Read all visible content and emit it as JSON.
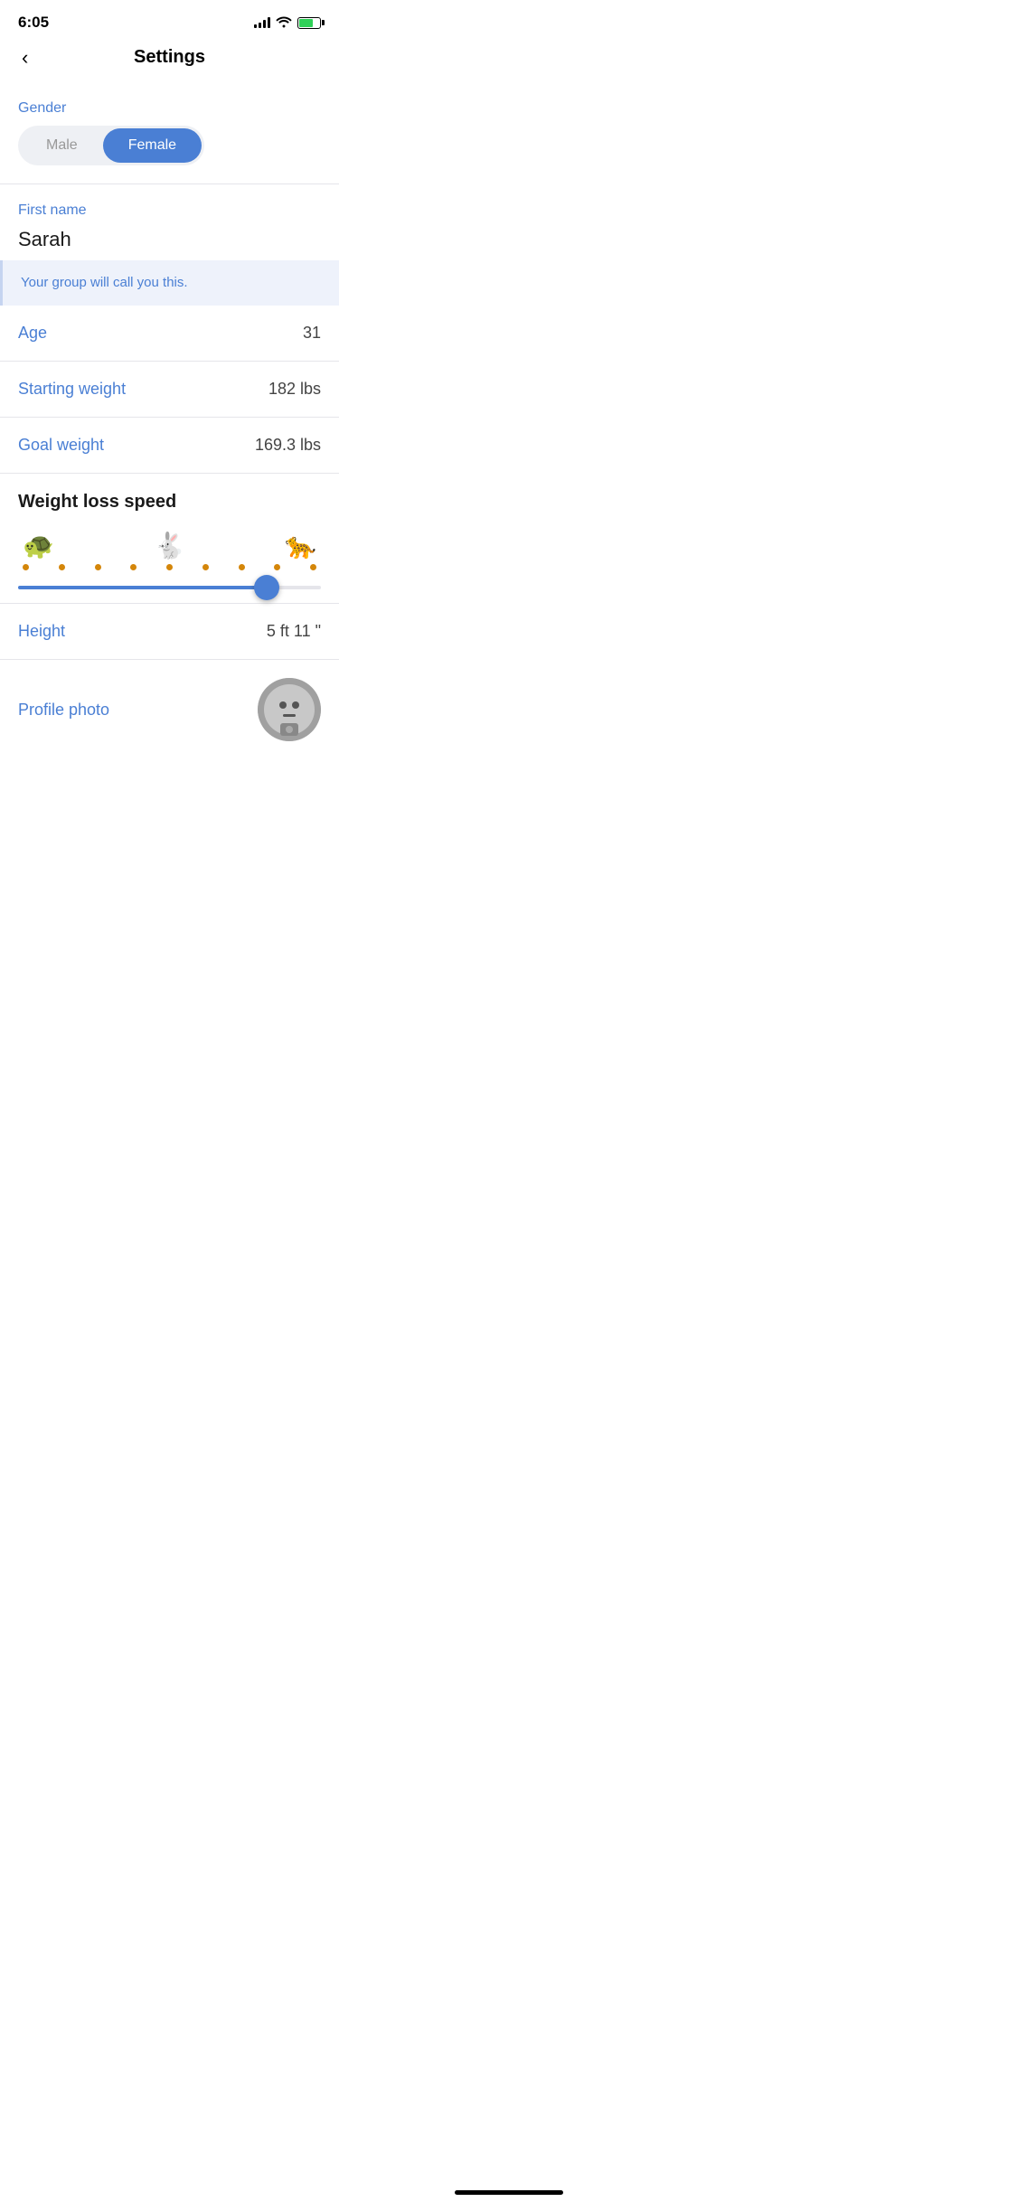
{
  "statusBar": {
    "time": "6:05",
    "batteryColor": "#30d158"
  },
  "header": {
    "backLabel": "‹",
    "title": "Settings"
  },
  "gender": {
    "label": "Gender",
    "options": [
      "Male",
      "Female"
    ],
    "selected": "Female"
  },
  "firstName": {
    "label": "First name",
    "value": "Sarah",
    "tooltip": "Your group will call you this."
  },
  "age": {
    "label": "Age",
    "value": "31"
  },
  "startingWeight": {
    "label": "Starting weight",
    "value": "182 lbs"
  },
  "goalWeight": {
    "label": "Goal weight",
    "value": "169.3 lbs"
  },
  "weightLossSpeed": {
    "title": "Weight loss speed",
    "sliderValue": 85,
    "animals": {
      "slow": "🐢",
      "medium": "🐇",
      "fast": "🐆"
    }
  },
  "height": {
    "label": "Height",
    "value": "5 ft 11 \""
  },
  "profilePhoto": {
    "label": "Profile photo"
  }
}
